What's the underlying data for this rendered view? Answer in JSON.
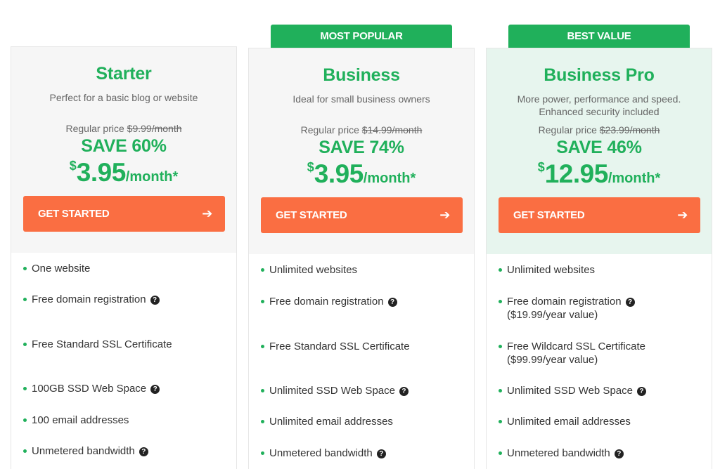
{
  "ribbons": {
    "business": "MOST POPULAR",
    "pro": "BEST VALUE"
  },
  "plans": [
    {
      "name": "Starter",
      "desc": "Perfect for a basic blog or website",
      "regular_label": "Regular price",
      "regular_price": "$9.99/month",
      "save": "SAVE 60%",
      "currency": "$",
      "amount": "3.95",
      "per": "/month*",
      "cta": "GET STARTED",
      "features": [
        "One website",
        "Free domain registration",
        "Free Standard SSL Certificate",
        "100GB SSD Web Space",
        "100 email addresses",
        "Unmetered bandwidth"
      ]
    },
    {
      "name": "Business",
      "desc": "Ideal for small business owners",
      "regular_label": "Regular price",
      "regular_price": "$14.99/month",
      "save": "SAVE 74%",
      "currency": "$",
      "amount": "3.95",
      "per": "/month*",
      "cta": "GET STARTED",
      "features": [
        "Unlimited websites",
        "Free domain registration",
        "Free Standard SSL Certificate",
        "Unlimited SSD Web Space",
        "Unlimited email addresses",
        "Unmetered bandwidth"
      ]
    },
    {
      "name": "Business Pro",
      "desc_line1": "More power, performance and speed.",
      "desc_line2": "Enhanced security included",
      "regular_label": "Regular price",
      "regular_price": "$23.99/month",
      "save": "SAVE 46%",
      "currency": "$",
      "amount": "12.95",
      "per": "/month*",
      "cta": "GET STARTED",
      "features": [
        "Unlimited websites",
        "Free domain registration",
        "($19.99/year value)",
        "Free Wildcard SSL Certificate",
        "($99.99/year value)",
        "Unlimited SSD Web Space",
        "Unlimited email addresses",
        "Unmetered bandwidth"
      ]
    }
  ],
  "icons": {
    "help": "question-circle-icon",
    "arrow": "arrow-right-icon",
    "bullet": "bullet-dot-icon"
  },
  "colors": {
    "green": "#20b05b",
    "orange": "#fa6e42",
    "card_bg": "#f6f6f6",
    "pro_bg": "#e7f5ee"
  }
}
